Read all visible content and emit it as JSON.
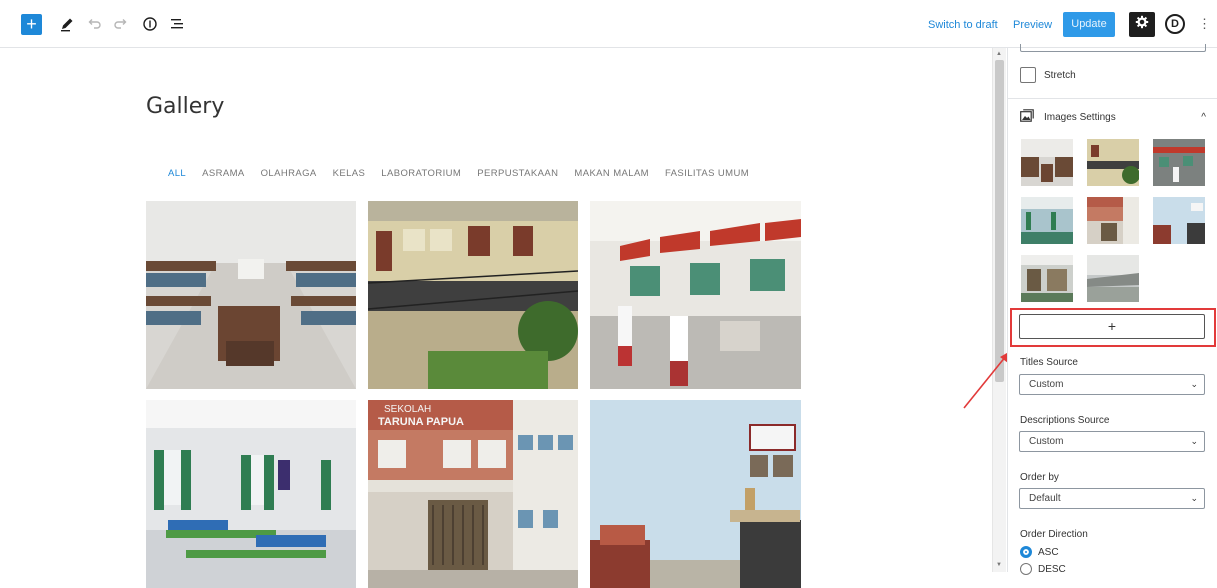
{
  "toolbar": {
    "add_label": "+",
    "switch_to_draft": "Switch to draft",
    "preview": "Preview",
    "update": "Update",
    "options_letter": "D",
    "more": "⋮",
    "icons": [
      "plus-icon",
      "pencil-icon",
      "undo-icon",
      "redo-icon",
      "info-icon",
      "list-view-icon",
      "gear-icon",
      "more-vertical-icon"
    ]
  },
  "editor": {
    "title": "Gallery",
    "filters": [
      {
        "label": "ALL",
        "active": true
      },
      {
        "label": "ASRAMA",
        "active": false
      },
      {
        "label": "OLAHRAGA",
        "active": false
      },
      {
        "label": "KELAS",
        "active": false
      },
      {
        "label": "LABORATORIUM",
        "active": false
      },
      {
        "label": "PERPUSTAKAAN",
        "active": false
      },
      {
        "label": "MAKAN MALAM",
        "active": false
      },
      {
        "label": "FASILITAS UMUM",
        "active": false
      }
    ],
    "photos": [
      {
        "name": "dormitory-bunk-beds-photo"
      },
      {
        "name": "school-building-corridor-photo"
      },
      {
        "name": "classroom-students-photo"
      },
      {
        "name": "dormitory-room-green-curtains-photo"
      },
      {
        "name": "school-building-sign-photo",
        "sign_text": "SEKOLAH TARUNA PAPUA"
      },
      {
        "name": "office-room-photo"
      }
    ]
  },
  "sidebar": {
    "stretch_label": "Stretch",
    "images_settings_label": "Images Settings",
    "add_image_label": "+",
    "titles_source": {
      "label": "Titles Source",
      "value": "Custom"
    },
    "descriptions_source": {
      "label": "Descriptions Source",
      "value": "Custom"
    },
    "order_by": {
      "label": "Order by",
      "value": "Default"
    },
    "order_direction": {
      "label": "Order Direction",
      "options": [
        "ASC",
        "DESC"
      ],
      "selected": "ASC"
    },
    "thumbnail_count": 8
  },
  "colors": {
    "accent": "#1e88d8",
    "highlight": "#e23a3a",
    "toolbar_dark": "#1e1e1e"
  }
}
